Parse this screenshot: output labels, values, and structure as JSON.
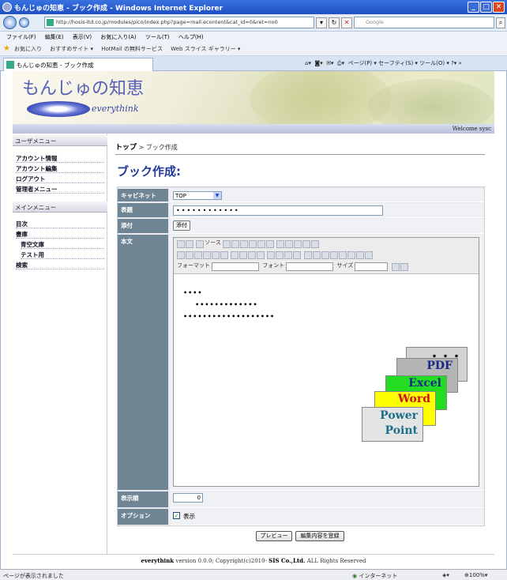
{
  "window": {
    "title": "もんじゅの知恵 - ブック作成 - Windows Internet Explorer"
  },
  "browser": {
    "address": "http://hosis-ltd.co.jp/modules/pico/index.php?page=mail.econtent&cat_id=0&ret=no0",
    "search_placeholder": "Google",
    "menu": [
      "ファイル(F)",
      "編集(E)",
      "表示(V)",
      "お気に入り(A)",
      "ツール(T)",
      "ヘルプ(H)"
    ],
    "favorites": [
      "お気に入り",
      "おすすめサイト ▾",
      "HotMail の無料サービス",
      "Web スライス ギャラリー ▾"
    ],
    "tab_label": "もんじゅの知恵 - ブック作成",
    "tab_tools": "ページ(P) ▾  セーフティ(S) ▾  ツール(O) ▾  ?▾  »",
    "status_left": "ページが表示されました",
    "status_zone": "インターネット",
    "zoom": "100%"
  },
  "banner": {
    "title": "もんじゅの知恵",
    "logo_text": "everythink",
    "welcome": "Welcome sysc"
  },
  "sidebar": {
    "user_menu_title": "ユーザメニュー",
    "user_items": [
      "アカウント情報",
      "アカウント編集",
      "ログアウト",
      "管理者メニュー"
    ],
    "main_menu_title": "メインメニュー",
    "main_items": [
      "目次",
      "書庫",
      "青空文庫",
      "テスト用",
      "検索"
    ]
  },
  "page": {
    "breadcrumb_top": "トップ",
    "breadcrumb_current": " > ブック作成",
    "title": "ブック作成:"
  },
  "form": {
    "labels": {
      "cabinet": "キャビネット",
      "title": "表題",
      "attach": "添付",
      "body": "本文",
      "order": "表示順",
      "option": "オプション"
    },
    "cabinet_value": "TOP",
    "title_value": "••••••••••••",
    "attach_button": "添付",
    "editor_toolbar": {
      "source": "ソース",
      "format": "フォーマット",
      "font": "フォント",
      "size": "サイズ"
    },
    "body_text": "••••\n    •••••••••••••\n•••••••••••••••••••",
    "order_value": "0",
    "option_label": "表示",
    "option_checked": "✓"
  },
  "cards": [
    "・・・",
    "PDF",
    "Excel",
    "Word",
    "Power\nPoint"
  ],
  "buttons": {
    "preview": "プレビュー",
    "save": "編集内容を登録"
  },
  "footer": {
    "brand": "everythink",
    "text": " version 0.0.0; Copyright(c)2010- ",
    "company": "SIS Co.,Ltd.",
    "rights": " ALL Rights Reserved"
  },
  "colors": {
    "title_blue": "#233a9a",
    "label_bg": "#6f8594",
    "ie_blue": "#1f4fc4"
  }
}
